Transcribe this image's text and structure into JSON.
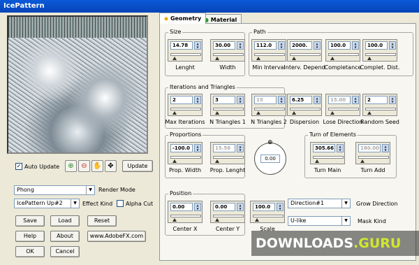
{
  "window": {
    "title": "IcePattern"
  },
  "left": {
    "auto_update_label": "Auto Update",
    "update_button": "Update",
    "render_mode_value": "Phong",
    "render_mode_label": "Render Mode",
    "effect_kind_value": "IcePattern Up#2",
    "effect_kind_label": "Effect Kind",
    "alpha_cut_label": "Alpha Cut",
    "save_button": "Save",
    "load_button": "Load",
    "reset_button": "Reset",
    "help_button": "Help",
    "about_button": "About",
    "website_button": "www.AdobeFX.com",
    "ok_button": "OK",
    "cancel_button": "Cancel"
  },
  "tabs": [
    {
      "label": "Geometry"
    },
    {
      "label": "Material"
    }
  ],
  "groups": {
    "size": "Size",
    "path": "Path",
    "iterations": "Iterations and Triangles",
    "proportions": "Proportions",
    "turn": "Turn of Elements",
    "position": "Position"
  },
  "controls": {
    "length": {
      "value": "14.78",
      "label": "Lenght"
    },
    "width": {
      "value": "30.00",
      "label": "Width"
    },
    "min_interval": {
      "value": "112.0",
      "label": "Min Interval"
    },
    "interv_depend": {
      "value": "2000.",
      "label": "Interv. Depend"
    },
    "completance": {
      "value": "100.0",
      "label": "Completance"
    },
    "complet_dist": {
      "value": "100.0",
      "label": "Complet. Dist."
    },
    "max_iterations": {
      "value": "2",
      "label": "Max Iterations"
    },
    "n_triangles_1": {
      "value": "3",
      "label": "N Triangles 1"
    },
    "n_triangles_2": {
      "value": "15",
      "label": "N Triangles 2"
    },
    "dispersion": {
      "value": "6.25",
      "label": "Dispersion"
    },
    "lose_direction": {
      "value": "15.00",
      "label": "Lose Direction"
    },
    "random_seed": {
      "value": "2",
      "label": "Random Seed"
    },
    "prop_width": {
      "value": "-100.0",
      "label": "Prop. Width"
    },
    "prop_length": {
      "value": "15.56",
      "label": "Prop. Lenght"
    },
    "dial_value": "0.00",
    "turn_main": {
      "value": "305.66",
      "label": "Turn Main"
    },
    "turn_add": {
      "value": "180.00",
      "label": "Turn Add"
    },
    "center_x": {
      "value": "0.00",
      "label": "Center X"
    },
    "center_y": {
      "value": "0.00",
      "label": "Center Y"
    },
    "scale": {
      "value": "100.0",
      "label": "Scale"
    },
    "grow_direction_value": "Direction#1",
    "grow_direction_label": "Grow Direction",
    "mask_kind_value": "U-like",
    "mask_kind_label": "Mask Kind"
  },
  "watermark": {
    "part1": "DOWNLOADS",
    "part2": ".GURU"
  }
}
